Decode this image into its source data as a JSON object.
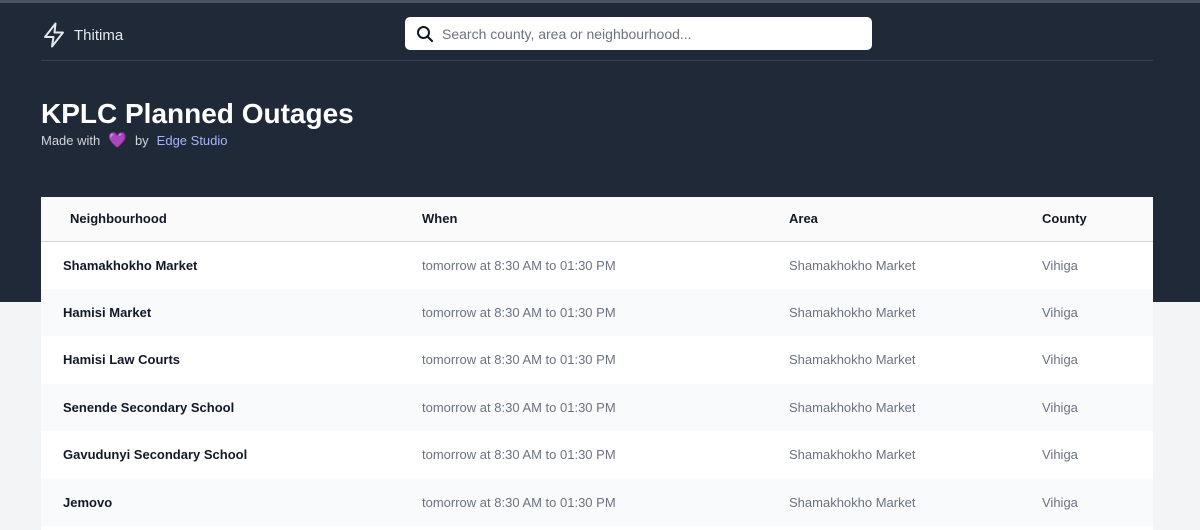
{
  "brand": {
    "name": "Thitima",
    "icon": "lightning-bolt-icon"
  },
  "search": {
    "placeholder": "Search county, area or neighbourhood...",
    "value": "",
    "icon": "search-icon"
  },
  "header": {
    "title": "KPLC Planned Outages",
    "made_with": "Made with",
    "heart": "💜",
    "by": "by",
    "studio": "Edge Studio"
  },
  "table": {
    "columns": [
      "Neighbourhood",
      "When",
      "Area",
      "County"
    ],
    "rows": [
      {
        "neighbourhood": "Shamakhokho Market",
        "when": "tomorrow at 8:30 AM to 01:30 PM",
        "area": "Shamakhokho Market",
        "county": "Vihiga"
      },
      {
        "neighbourhood": "Hamisi Market",
        "when": "tomorrow at 8:30 AM to 01:30 PM",
        "area": "Shamakhokho Market",
        "county": "Vihiga"
      },
      {
        "neighbourhood": "Hamisi Law Courts",
        "when": "tomorrow at 8:30 AM to 01:30 PM",
        "area": "Shamakhokho Market",
        "county": "Vihiga"
      },
      {
        "neighbourhood": "Senende Secondary School",
        "when": "tomorrow at 8:30 AM to 01:30 PM",
        "area": "Shamakhokho Market",
        "county": "Vihiga"
      },
      {
        "neighbourhood": "Gavudunyi Secondary School",
        "when": "tomorrow at 8:30 AM to 01:30 PM",
        "area": "Shamakhokho Market",
        "county": "Vihiga"
      },
      {
        "neighbourhood": "Jemovo",
        "when": "tomorrow at 8:30 AM to 01:30 PM",
        "area": "Shamakhokho Market",
        "county": "Vihiga"
      }
    ]
  },
  "colors": {
    "header_bg": "#1f2937",
    "page_bg": "#f3f4f6",
    "accent_link": "#a5b4fc",
    "heart": "#a855f7"
  }
}
